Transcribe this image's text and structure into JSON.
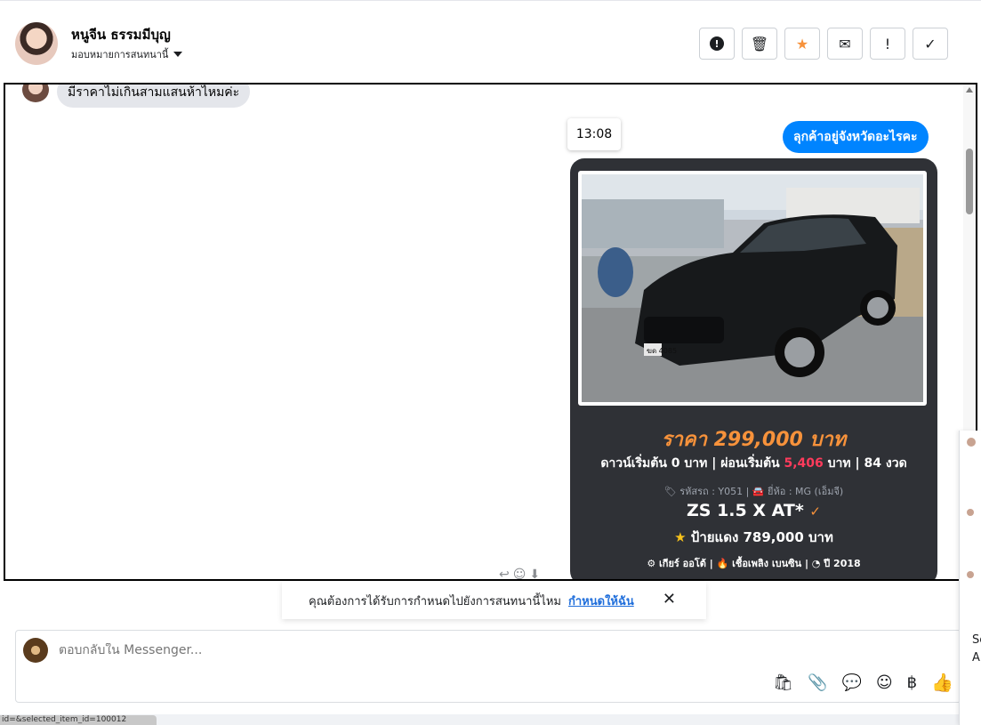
{
  "header": {
    "contact_name": "หนูจีน ธรรมมีบุญ",
    "assign_label": "มอบหมายการสนทนานี้",
    "actions": [
      {
        "name": "spam-icon",
        "glyph": "!"
      },
      {
        "name": "trash-icon",
        "glyph": "🗑"
      },
      {
        "name": "star-icon",
        "glyph": "★"
      },
      {
        "name": "mail-icon",
        "glyph": "✉"
      },
      {
        "name": "exclamation-icon",
        "glyph": "!"
      },
      {
        "name": "check-icon",
        "glyph": "✓"
      }
    ]
  },
  "conversation": {
    "incoming_text": "มีราคาไม่เกินสามแสนห้าไหมค่ะ",
    "timestamp": "13:08",
    "outgoing_text": "ลุกค้าอยู่จังหวัดอะไรคะ"
  },
  "car_card": {
    "price": "ราคา 299,000 บาท",
    "down_prefix": "ดาวน์เริ่มต้น 0 บาท | ผ่อนเริ่มต้น",
    "installment": "5,406",
    "down_suffix": "บาท | 84 งวด",
    "meta": "🏷 รหัสรถ : Y051 | 🚘 ยี่ห้อ : MG (เอ็มจี)",
    "model": "ZS 1.5 X AT*",
    "red_plate": "ป้ายแดง 789,000 บาท",
    "specs": "⚙ เกียร์ ออโต้   |   🔥 เชื้อเพลิง เบนซิน   |   ◔ ปี 2018",
    "plate_text": "ฆด 4085"
  },
  "assign_prompt": {
    "text": "คุณต้องการได้รับการกำหนดไปยังการสนทนานี้ไหม",
    "link": "กำหนดให้ฉัน",
    "close": "✕"
  },
  "composer": {
    "placeholder": "ตอบกลับใน Messenger..."
  },
  "tools": [
    {
      "name": "shopping-bag-icon",
      "glyph": "🛍"
    },
    {
      "name": "paperclip-icon",
      "glyph": "📎"
    },
    {
      "name": "saved-replies-icon",
      "glyph": "💬"
    },
    {
      "name": "emoji-icon",
      "glyph": "☺"
    },
    {
      "name": "baht-icon",
      "glyph": "฿"
    },
    {
      "name": "like-icon",
      "glyph": "👍"
    }
  ],
  "status_bar": {
    "text": "id=&selected_item_id=100012"
  },
  "side_panel": {
    "text_a": "Sc",
    "text_b": "A"
  },
  "colors": {
    "accent": "#0084ff",
    "price_orange": "#f7923b",
    "card_bg": "#2f3136",
    "installment_red": "#ff3b5c"
  }
}
